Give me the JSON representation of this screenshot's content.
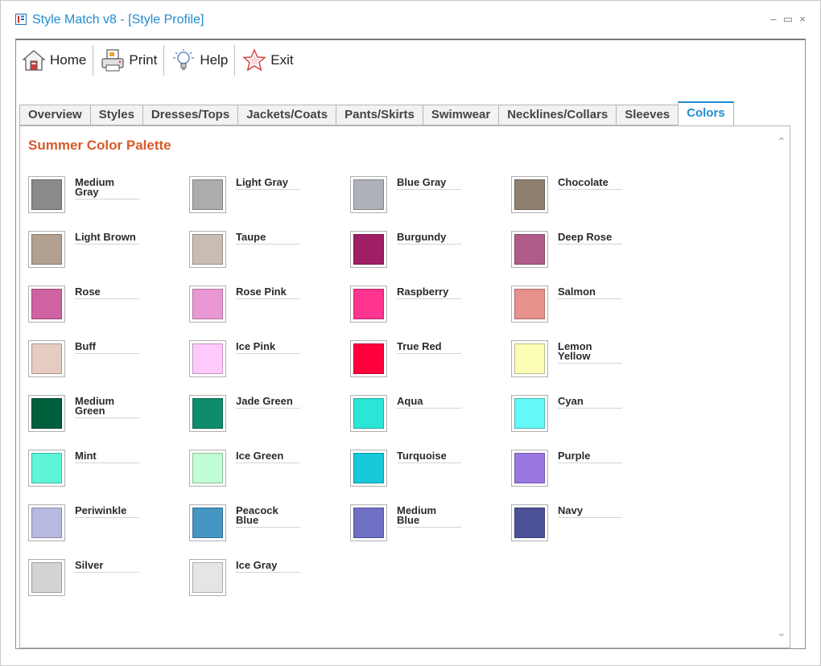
{
  "window": {
    "title": "Style Match v8 - [Style Profile]",
    "minimize_label": "–",
    "maximize_label": "▭",
    "close_label": "×"
  },
  "toolbar": {
    "home_label": "Home",
    "print_label": "Print",
    "help_label": "Help",
    "exit_label": "Exit"
  },
  "tabs": [
    {
      "label": "Overview",
      "active": false
    },
    {
      "label": "Styles",
      "active": false
    },
    {
      "label": "Dresses/Tops",
      "active": false
    },
    {
      "label": "Jackets/Coats",
      "active": false
    },
    {
      "label": "Pants/Skirts",
      "active": false
    },
    {
      "label": "Swimwear",
      "active": false
    },
    {
      "label": "Necklines/Collars",
      "active": false
    },
    {
      "label": "Sleeves",
      "active": false
    },
    {
      "label": "Colors",
      "active": true
    }
  ],
  "palette": {
    "heading": "Summer Color Palette",
    "colors": [
      {
        "name": "Medium Gray",
        "hex": "#8a8a8a"
      },
      {
        "name": "Light Gray",
        "hex": "#acacac"
      },
      {
        "name": "Blue Gray",
        "hex": "#aeb1b8"
      },
      {
        "name": "Chocolate",
        "hex": "#8f8070"
      },
      {
        "name": "Light Brown",
        "hex": "#b2a191"
      },
      {
        "name": "Taupe",
        "hex": "#c8bdb2"
      },
      {
        "name": "Burgundy",
        "hex": "#9e1f66"
      },
      {
        "name": "Deep Rose",
        "hex": "#b05c88"
      },
      {
        "name": "Rose",
        "hex": "#cf62a0"
      },
      {
        "name": "Rose Pink",
        "hex": "#ea98d4"
      },
      {
        "name": "Raspberry",
        "hex": "#ff3590"
      },
      {
        "name": "Salmon",
        "hex": "#e6918c"
      },
      {
        "name": "Buff",
        "hex": "#e6cbc2"
      },
      {
        "name": "Ice Pink",
        "hex": "#fec9fd"
      },
      {
        "name": "True Red",
        "hex": "#ff003c"
      },
      {
        "name": "Lemon Yellow",
        "hex": "#fbfcb6"
      },
      {
        "name": "Medium Green",
        "hex": "#005f3c"
      },
      {
        "name": "Jade Green",
        "hex": "#0e8c6b"
      },
      {
        "name": "Aqua",
        "hex": "#2be5d7"
      },
      {
        "name": "Cyan",
        "hex": "#64f8f6"
      },
      {
        "name": "Mint",
        "hex": "#5ef5d8"
      },
      {
        "name": "Ice Green",
        "hex": "#c0fcd4"
      },
      {
        "name": "Turquoise",
        "hex": "#17c8da"
      },
      {
        "name": "Purple",
        "hex": "#9a76e0"
      },
      {
        "name": "Periwinkle",
        "hex": "#b8b9e0"
      },
      {
        "name": "Peacock Blue",
        "hex": "#4596c3"
      },
      {
        "name": "Medium Blue",
        "hex": "#6f70c4"
      },
      {
        "name": "Navy",
        "hex": "#4d5196"
      },
      {
        "name": "Silver",
        "hex": "#d3d3d5"
      },
      {
        "name": "Ice Gray",
        "hex": "#e5e5e5"
      }
    ]
  }
}
